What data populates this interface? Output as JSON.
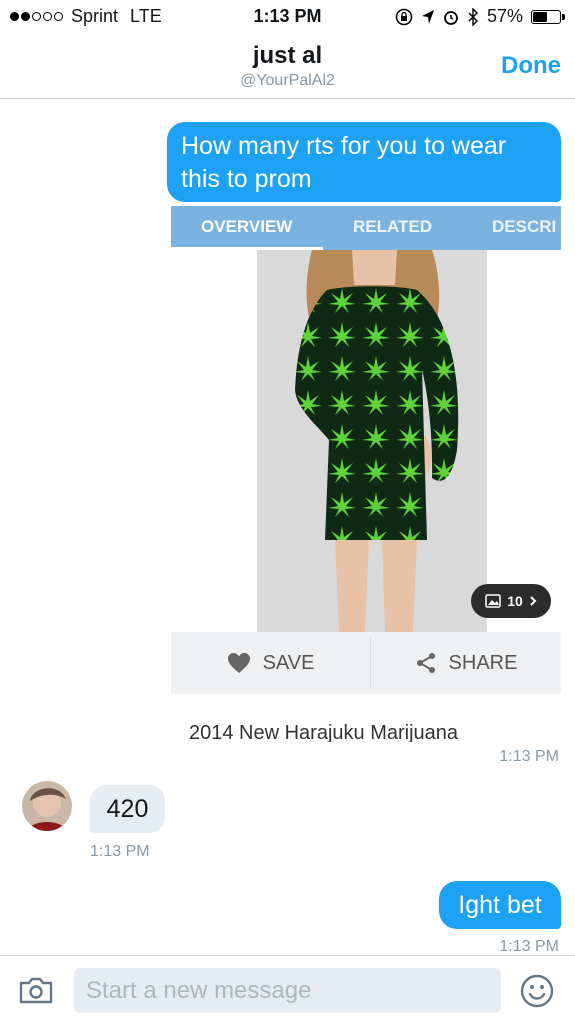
{
  "status_bar": {
    "carrier": "Sprint",
    "network": "LTE",
    "time": "1:13 PM",
    "battery": "57%",
    "battery_level": 0.57,
    "signal_bars_filled": 2,
    "signal_bars_total": 5
  },
  "header": {
    "name": "just al",
    "handle": "@YourPalAl2",
    "done_label": "Done"
  },
  "messages": {
    "m1_text": "How many rts for you to wear this to prom",
    "card": {
      "tabs": [
        "OVERVIEW",
        "RELATED",
        "DESCRI"
      ],
      "active_tab": "OVERVIEW",
      "image_count": "10",
      "save_label": "SAVE",
      "share_label": "SHARE",
      "caption": "2014 New Harajuku Marijuana"
    },
    "m1_time": "1:13 PM",
    "m2_text": "420",
    "m2_time": "1:13 PM",
    "m3_text": "Ight bet",
    "m3_time": "1:13 PM"
  },
  "composer": {
    "placeholder": "Start a new message"
  },
  "colors": {
    "accent": "#1da1f2",
    "tab_bar": "#7ab3e0",
    "incoming_bubble": "#e6ecf0"
  },
  "icons": [
    "location-arrow-icon",
    "alarm-icon",
    "bluetooth-icon",
    "lock-rotation-icon",
    "heart-icon",
    "share-icon",
    "gallery-icon",
    "chevron-right-icon",
    "camera-icon",
    "emoji-icon"
  ]
}
